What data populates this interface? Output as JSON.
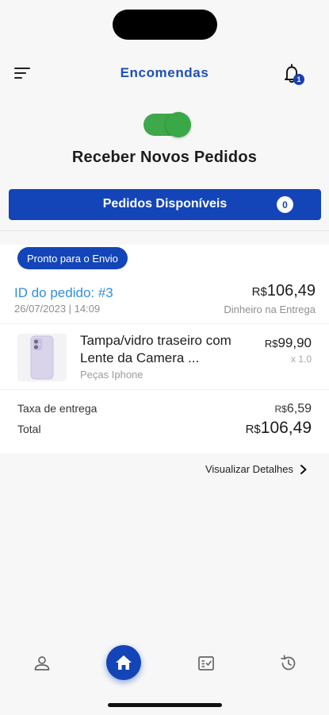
{
  "header": {
    "title": "Encomendas",
    "notification_count": "1"
  },
  "receive_orders": {
    "label": "Receber Novos Pedidos",
    "enabled": true
  },
  "available_orders": {
    "label": "Pedidos Disponíveis",
    "count": "0"
  },
  "order": {
    "status": "Pronto para o Envio",
    "id_label": "ID do pedido: #3",
    "total_currency": "R$",
    "total_amount": "106,49",
    "date": "26/07/2023 | 14:09",
    "payment_method": "Dinheiro na Entrega",
    "items": [
      {
        "name": "Tampa/vidro traseiro com Lente da Camera ...",
        "category": "Peças Iphone",
        "price_currency": "R$",
        "price_amount": "99,90",
        "quantity": "x 1.0"
      }
    ],
    "delivery_fee_label": "Taxa de entrega",
    "delivery_fee_currency": "R$",
    "delivery_fee_amount": "6,59",
    "summary_total_label": "Total",
    "summary_total_currency": "R$",
    "summary_total_amount": "106,49",
    "details_link": "Visualizar Detalhes"
  },
  "bottom_nav": {
    "items": [
      "profile-icon",
      "home-icon",
      "orders-list-icon",
      "history-icon"
    ],
    "active": "home-icon"
  },
  "colors": {
    "primary": "#1445b8",
    "title_blue": "#1e4fb5",
    "toggle_green": "#3ea84a",
    "order_id_blue": "#2f8fe0",
    "muted_text": "#8f8f94"
  }
}
